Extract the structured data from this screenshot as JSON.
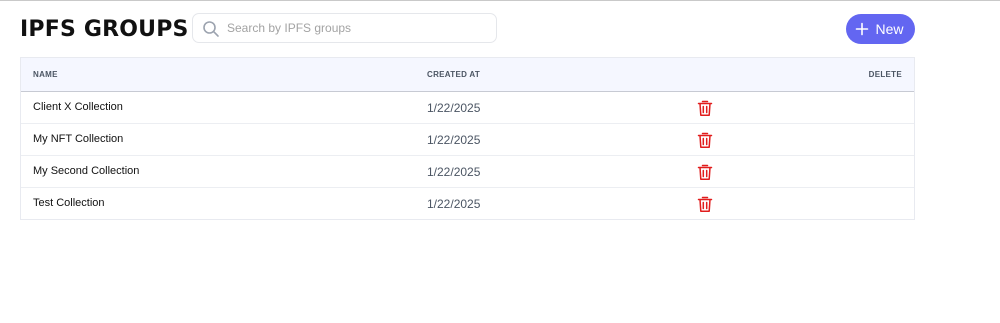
{
  "header": {
    "title": "IPFS GROUPS"
  },
  "search": {
    "placeholder": "Search by IPFS groups",
    "value": ""
  },
  "actions": {
    "new_label": "New"
  },
  "table": {
    "columns": [
      "NAME",
      "CREATED AT",
      "DELETE"
    ],
    "rows": [
      {
        "name": "Client X Collection",
        "created_at": "1/22/2025"
      },
      {
        "name": "My NFT Collection",
        "created_at": "1/22/2025"
      },
      {
        "name": "My Second Collection",
        "created_at": "1/22/2025"
      },
      {
        "name": "Test Collection",
        "created_at": "1/22/2025"
      }
    ]
  },
  "icons": {
    "search": "search-icon",
    "new": "plus-icon",
    "delete": "trash-icon"
  },
  "colors": {
    "accent": "#6366f1",
    "delete": "#e11d1d",
    "header_bg": "#f5f7ff"
  }
}
